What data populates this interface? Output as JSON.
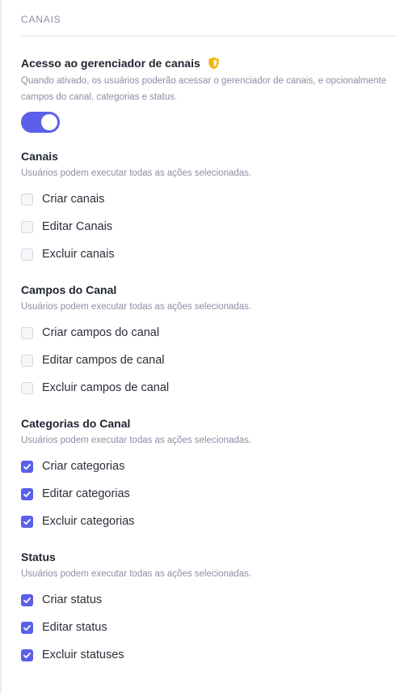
{
  "section": {
    "title": "CANAIS"
  },
  "access": {
    "title": "Acesso ao gerenciador de canais",
    "badge_icon": "shield-icon",
    "badge_color": "#f5b301",
    "description": "Quando ativado, os usuários poderão acessar o gerenciador de canais, e opcionalmente campos do canal, categorias e status.",
    "toggle_on": true,
    "accent_color": "#5b5fe9"
  },
  "groups": [
    {
      "title": "Canais",
      "description": "Usuários podem executar todas as ações selecionadas.",
      "options": [
        {
          "label": "Criar canais",
          "checked": false
        },
        {
          "label": "Editar Canais",
          "checked": false
        },
        {
          "label": "Excluir canais",
          "checked": false
        }
      ]
    },
    {
      "title": "Campos do Canal",
      "description": "Usuários podem executar todas as ações selecionadas.",
      "options": [
        {
          "label": "Criar campos do canal",
          "checked": false
        },
        {
          "label": "Editar campos de canal",
          "checked": false
        },
        {
          "label": "Excluir campos de canal",
          "checked": false
        }
      ]
    },
    {
      "title": "Categorias do Canal",
      "description": "Usuários podem executar todas as ações selecionadas.",
      "options": [
        {
          "label": "Criar categorias",
          "checked": true
        },
        {
          "label": "Editar categorias",
          "checked": true
        },
        {
          "label": "Excluir categorias",
          "checked": true
        }
      ]
    },
    {
      "title": "Status",
      "description": "Usuários podem executar todas as ações selecionadas.",
      "options": [
        {
          "label": "Criar status",
          "checked": true
        },
        {
          "label": "Editar status",
          "checked": true
        },
        {
          "label": "Excluir statuses",
          "checked": true
        }
      ]
    }
  ]
}
